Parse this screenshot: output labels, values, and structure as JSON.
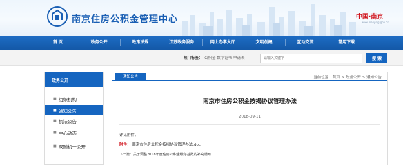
{
  "header": {
    "site_title": "南京住房公积金管理中心",
    "brand": "中国·南京",
    "brand_url": "www.nanjing.gov.cn"
  },
  "nav": {
    "items": [
      "首 页",
      "政务公开",
      "政策法规",
      "江苏政务服务",
      "网上办事大厅",
      "文明创建",
      "互动交流",
      "常用下载"
    ]
  },
  "search": {
    "hot_label": "热门标签：",
    "hot_words": "公积金  数字证书  申请表",
    "placeholder": "请输入关键字",
    "button_label": "搜 索"
  },
  "sidebar": {
    "title": "政务公开",
    "items": [
      {
        "label": "组织机构",
        "active": false
      },
      {
        "label": "通知公告",
        "active": true
      },
      {
        "label": "执法公告",
        "active": false
      },
      {
        "label": "中心动态",
        "active": false
      },
      {
        "label": "双随机一公开",
        "active": false
      }
    ]
  },
  "content": {
    "tab_label": "通知公告",
    "breadcrumb": "当前位置：首页 > 政务公开 > 通知公告",
    "title": "南京市住房公积金按揭协议管理办法",
    "date": "2018-09-11",
    "body": "详见附件。",
    "attachment_label": "附件：",
    "attachment_name": "南京市住房公积金按揭协议管理办法.doc",
    "next": "下一篇：关于调整2018年度住房公积金缴存基数的补充通知"
  },
  "colors": {
    "primary": "#1565c0",
    "accent_red": "#d0121b"
  }
}
